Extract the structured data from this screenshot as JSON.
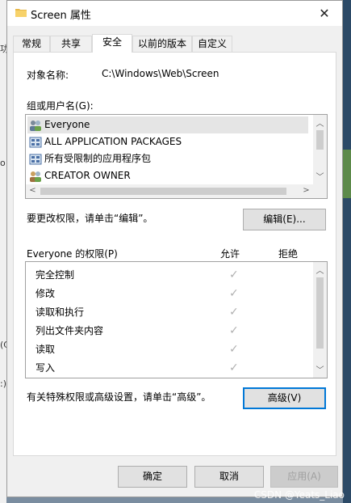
{
  "window": {
    "title": "Screen 属性",
    "close_label": "✕"
  },
  "tabs": [
    {
      "label": "常规",
      "active": false
    },
    {
      "label": "共享",
      "active": false
    },
    {
      "label": "安全",
      "active": true
    },
    {
      "label": "以前的版本",
      "active": false
    },
    {
      "label": "自定义",
      "active": false
    }
  ],
  "security": {
    "object_name_label": "对象名称:",
    "object_name_value": "C:\\Windows\\Web\\Screen",
    "groups_label": "组或用户名(G):",
    "groups": [
      {
        "name": "Everyone",
        "icon": "users-icon"
      },
      {
        "name": "ALL APPLICATION PACKAGES",
        "icon": "package-icon"
      },
      {
        "name": "所有受限制的应用程序包",
        "icon": "package-icon"
      },
      {
        "name": "CREATOR OWNER",
        "icon": "users-icon"
      }
    ],
    "edit_hint": "要更改权限，请单击“编辑”。",
    "edit_button": "编辑(E)...",
    "permissions_label": "Everyone 的权限(P)",
    "allow_header": "允许",
    "deny_header": "拒绝",
    "permissions": [
      {
        "name": "完全控制",
        "allow": true
      },
      {
        "name": "修改",
        "allow": true
      },
      {
        "name": "读取和执行",
        "allow": true
      },
      {
        "name": "列出文件夹内容",
        "allow": true
      },
      {
        "name": "读取",
        "allow": true
      },
      {
        "name": "写入",
        "allow": true
      }
    ],
    "advanced_hint": "有关特殊权限或高级设置，请单击“高级”。",
    "advanced_button": "高级(V)"
  },
  "footer": {
    "ok": "确定",
    "cancel": "取消",
    "apply": "应用(A)"
  },
  "watermark": "CSDN @Yeats_Liao",
  "background_fragments": [
    "功",
    "o",
    "(C",
    ":)"
  ],
  "colors": {
    "focus": "#0078d7",
    "check": "#b0b0b0"
  }
}
